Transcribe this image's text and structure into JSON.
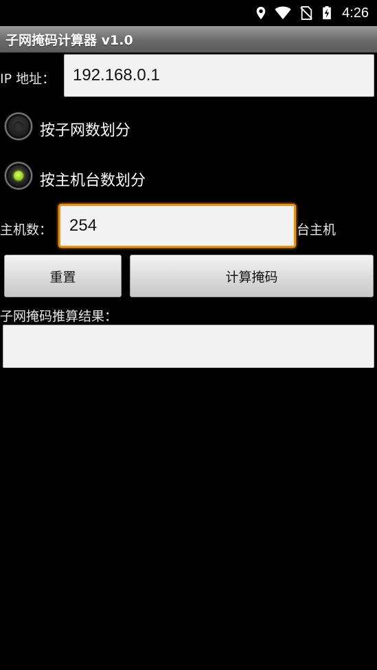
{
  "status_bar": {
    "time": "4:26",
    "icons": [
      "location-icon",
      "wifi-icon",
      "no-sim-icon",
      "battery-charging-icon"
    ]
  },
  "app": {
    "title": "子网掩码计算器 v1.0"
  },
  "ip": {
    "label": "IP 地址：",
    "value": "192.168.0.1"
  },
  "division": {
    "options": [
      {
        "label": "按子网数划分",
        "selected": false
      },
      {
        "label": "按主机台数划分",
        "selected": true
      }
    ]
  },
  "hosts": {
    "label": "主机数：",
    "value": "254",
    "unit": "台主机"
  },
  "buttons": {
    "reset": "重置",
    "calculate": "计算掩码"
  },
  "result": {
    "label": "子网掩码推算结果：",
    "value": ""
  },
  "colors": {
    "focus": "#f0900a",
    "radio_selected": "#9ad81a",
    "background": "#000000"
  }
}
